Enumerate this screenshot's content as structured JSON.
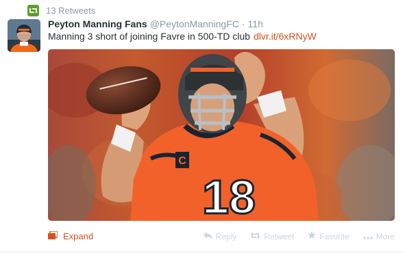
{
  "retweet_context": {
    "count_label": "13 Retweets",
    "icon": "retweet-icon",
    "color": "#5c9e2e"
  },
  "author": {
    "name": "Peyton Manning Fans",
    "handle": "@PeytonManningFC",
    "separator": "·",
    "time": "11h",
    "avatar_icon": "avatar"
  },
  "tweet": {
    "text": "Manning 3 short of joining Favre in 500-TD club",
    "link": "dlvr.it/6xRNyW"
  },
  "media": {
    "jersey_number": "18",
    "jersey_color": "#f2612a",
    "helmet_color": "#3f4548"
  },
  "footer": {
    "expand": "Expand",
    "reply": "Reply",
    "retweet": "Retweet",
    "favorite": "Favorite",
    "more": "More",
    "accent": "#d9501e"
  }
}
